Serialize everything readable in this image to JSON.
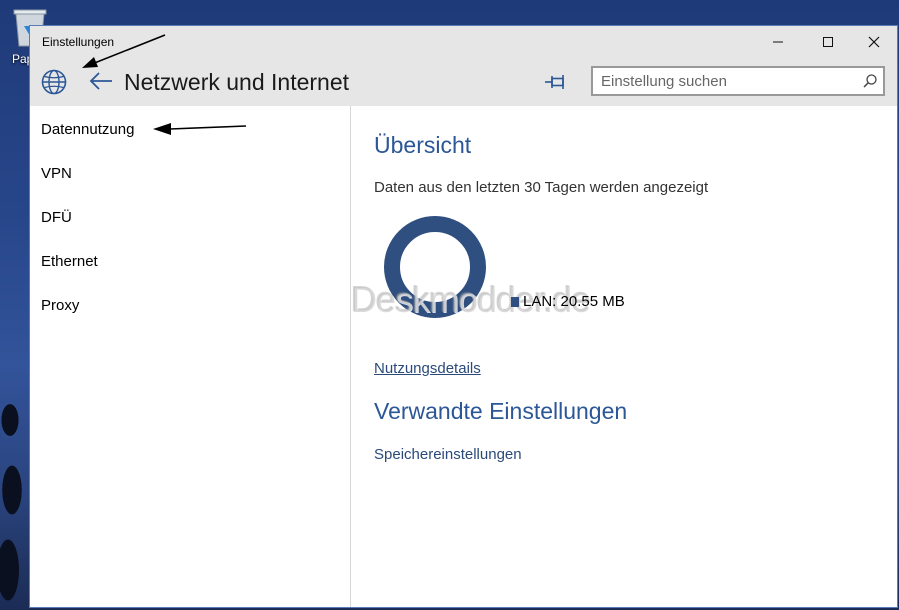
{
  "desktop": {
    "recycle_bin_label": "Pap"
  },
  "window": {
    "title": "Einstellungen",
    "controls": {
      "minimize_icon": "minimize-icon",
      "maximize_icon": "maximize-icon",
      "close_icon": "close-icon"
    }
  },
  "header": {
    "icon": "globe-icon",
    "back_icon": "back-arrow-icon",
    "title": "Netzwerk und Internet",
    "pin_icon": "pin-icon",
    "search": {
      "placeholder": "Einstellung suchen",
      "value": "",
      "icon": "search-icon"
    }
  },
  "sidebar": {
    "items": [
      {
        "label": "Datennutzung"
      },
      {
        "label": "VPN"
      },
      {
        "label": "DFÜ"
      },
      {
        "label": "Ethernet"
      },
      {
        "label": "Proxy"
      }
    ]
  },
  "main": {
    "overview_title": "Übersicht",
    "period_text": "Daten aus den letzten 30 Tagen werden angezeigt",
    "usage_legend": "LAN: 20.55 MB",
    "usage_details_link": "Nutzungsdetails",
    "related_title": "Verwandte Einstellungen",
    "storage_link": "Speichereinstellungen",
    "watermark": "Deskmodder.de"
  },
  "colors": {
    "accent": "#2b5797",
    "donut": "#2f4f80",
    "titlebar": "#e6e6e6"
  }
}
